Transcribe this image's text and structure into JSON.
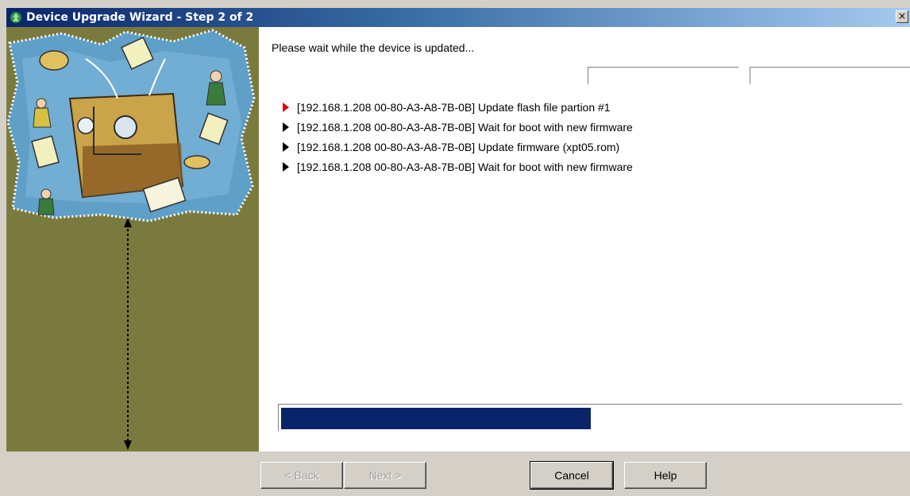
{
  "window": {
    "title": "Device Upgrade Wizard - Step 2 of 2",
    "close_glyph": "×",
    "icon": "wizard-tree-icon"
  },
  "content": {
    "status_text": "Please wait while the device is updated...",
    "tasks": [
      {
        "text": "[192.168.1.208 00-80-A3-A8-7B-0B] Update flash file partion #1",
        "state": "active"
      },
      {
        "text": "[192.168.1.208 00-80-A3-A8-7B-0B] Wait for boot with new firmware",
        "state": "pending"
      },
      {
        "text": "[192.168.1.208 00-80-A3-A8-7B-0B] Update firmware (xpt05.rom)",
        "state": "pending"
      },
      {
        "text": "[192.168.1.208 00-80-A3-A8-7B-0B] Wait for boot with new firmware",
        "state": "pending"
      }
    ],
    "progress_fraction": 0.5
  },
  "buttons": {
    "back": "< Back",
    "next": "Next >",
    "cancel": "Cancel",
    "help": "Help"
  },
  "colors": {
    "title_gradient_start": "#0a246a",
    "side_panel": "#7b7a3e",
    "progress_fill": "#0a246a",
    "active_arrow": "#e00000"
  }
}
